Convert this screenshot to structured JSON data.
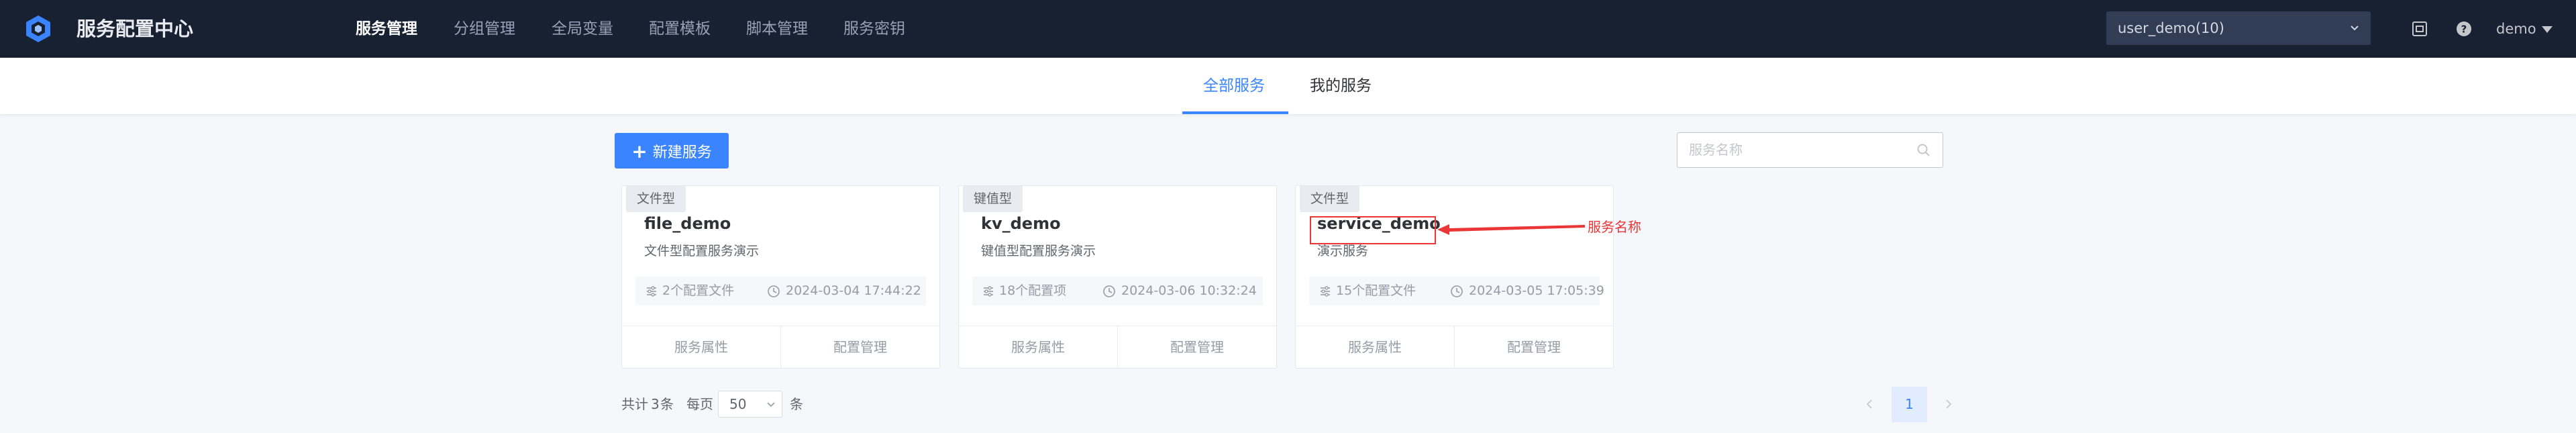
{
  "header": {
    "app_title": "服务配置中心",
    "menu": [
      "服务管理",
      "分组管理",
      "全局变量",
      "配置模板",
      "脚本管理",
      "服务密钥"
    ],
    "active_menu": "服务管理",
    "business_select": "user_demo(10)",
    "icons": [
      "logo-icon",
      "chevron-down-icon",
      "document-icon",
      "help-icon",
      "caret-down-icon"
    ],
    "user": "demo"
  },
  "tabs": {
    "all": "全部服务",
    "mine": "我的服务",
    "active": "全部服务"
  },
  "toolbar": {
    "new_button": "新建服务",
    "new_icon": "+",
    "search_placeholder": "服务名称"
  },
  "services": [
    {
      "type": "文件型",
      "name": "file_demo",
      "desc": "文件型配置服务演示",
      "count": "2个配置文件",
      "time": "2024-03-04 17:44:22",
      "action_props": "服务属性",
      "action_config": "配置管理"
    },
    {
      "type": "键值型",
      "name": "kv_demo",
      "desc": "键值型配置服务演示",
      "count": "18个配置项",
      "time": "2024-03-06 10:32:24",
      "action_props": "服务属性",
      "action_config": "配置管理"
    },
    {
      "type": "文件型",
      "name": "service_demo",
      "desc": "演示服务",
      "count": "15个配置文件",
      "time": "2024-03-05 17:05:39",
      "action_props": "服务属性",
      "action_config": "配置管理"
    }
  ],
  "annotation": {
    "label": "服务名称",
    "color": "#ea3636"
  },
  "pagination": {
    "total_prefix": "共计",
    "total": "3",
    "total_unit": "条",
    "per_page_label": "每页",
    "per_page": "50",
    "per_page_unit": "条",
    "current_page": "1"
  },
  "colors": {
    "nav_bg": "#182132",
    "primary": "#3a84ff",
    "page_bg": "#f5f7fa"
  }
}
